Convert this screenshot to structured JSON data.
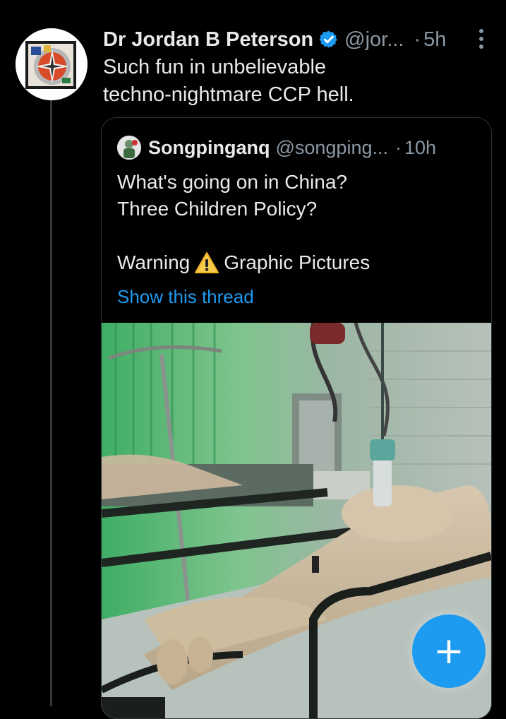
{
  "tweet": {
    "author_name": "Dr Jordan B Peterson",
    "handle": "@jor...",
    "separator": "·",
    "time": "5h",
    "text_lines": [
      "Such fun in unbelievable",
      "techno-nightmare CCP hell."
    ],
    "verified": true
  },
  "quote": {
    "author_name": "Songpinganq",
    "handle": "@songping...",
    "separator": "·",
    "time": "10h",
    "line1": "What's going on in China?",
    "line2": "Three Children Policy?",
    "warning_before": "Warning",
    "warning_after": "Graphic Pictures",
    "show_thread": "Show this thread"
  },
  "colors": {
    "background": "#000000",
    "text": "#e7e9ea",
    "secondary": "#8b98a5",
    "accent": "#1d9bf0"
  },
  "icons": {
    "verified": "verified-badge-icon",
    "more": "more-options-icon",
    "warning": "warning-icon",
    "compose": "plus-icon"
  }
}
